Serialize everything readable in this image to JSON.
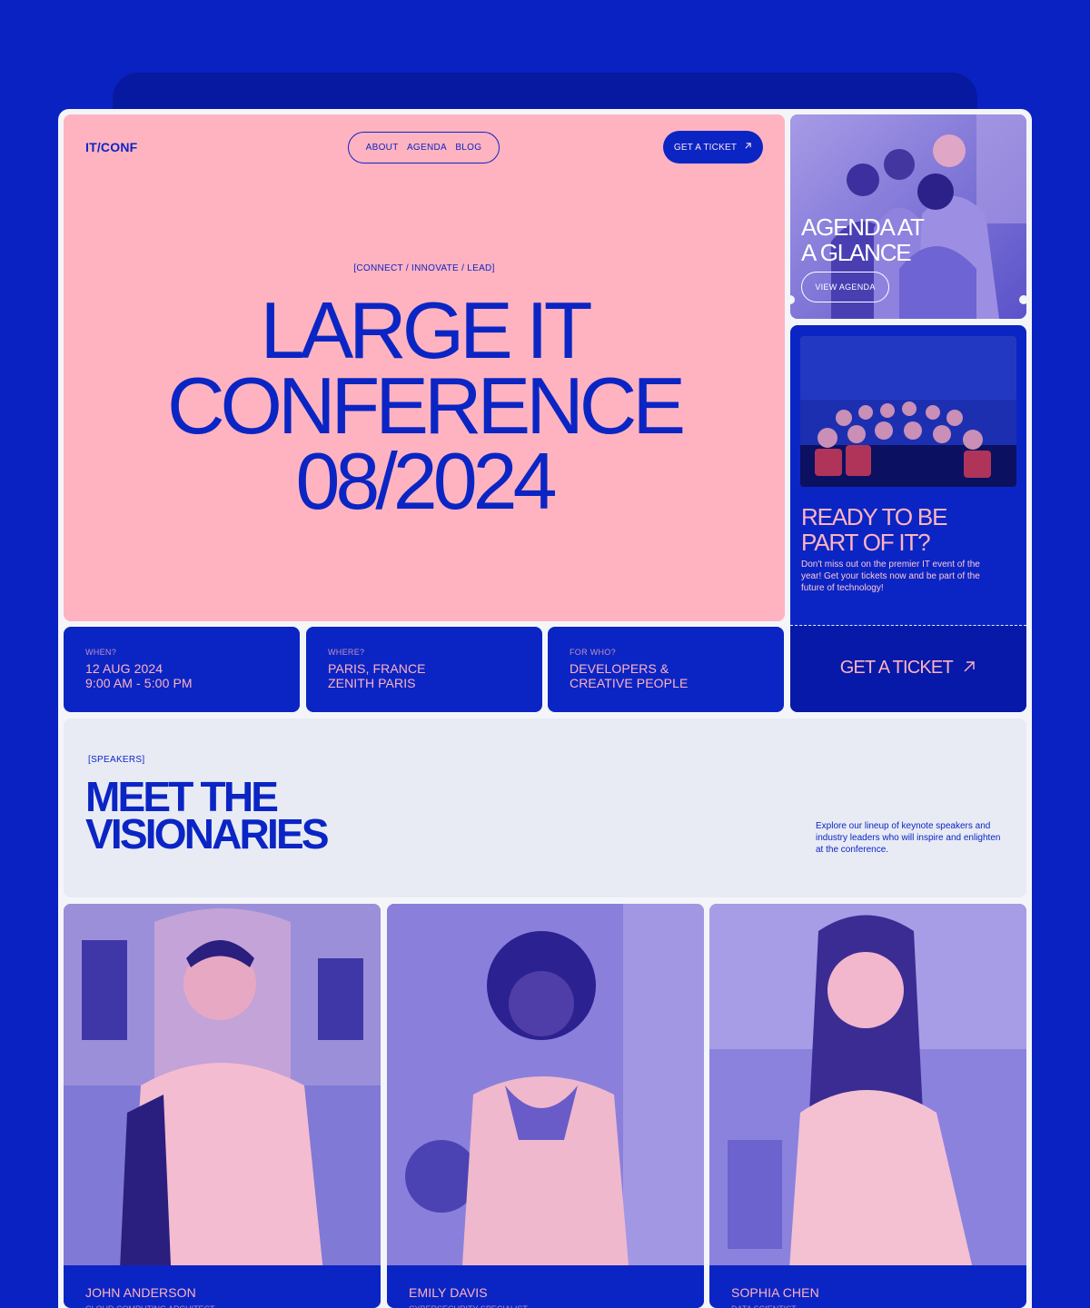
{
  "brand": {
    "logo": "IT/CONF"
  },
  "nav": {
    "items": [
      "ABOUT",
      "AGENDA",
      "BLOG"
    ],
    "cta": "GET A TICKET",
    "cta_icon": "arrow-up-right-icon"
  },
  "hero": {
    "tagline": "[CONNECT / INNOVATE / LEAD]",
    "title_lines": [
      "LARGE IT",
      "CONFERENCE",
      "08/2024"
    ]
  },
  "agenda_card": {
    "title_lines": [
      "AGENDA AT",
      "A GLANCE"
    ],
    "button": "VIEW AGENDA"
  },
  "ready_card": {
    "title_lines": [
      "READY TO BE",
      "PART OF IT?"
    ],
    "text": "Don't miss out on the premier IT event of the year! Get your tickets now and be part of the future of technology!",
    "cta": "GET A TICKET",
    "cta_icon": "arrow-up-right-icon"
  },
  "info": [
    {
      "label": "WHEN?",
      "lines": [
        "12 AUG 2024",
        "9:00 AM - 5:00 PM"
      ]
    },
    {
      "label": "WHERE?",
      "lines": [
        "PARIS, FRANCE",
        "ZENITH PARIS"
      ]
    },
    {
      "label": "FOR WHO?",
      "lines": [
        "DEVELOPERS &",
        "CREATIVE PEOPLE"
      ]
    }
  ],
  "speakers_section": {
    "tag": "[SPEAKERS]",
    "title_lines": [
      "MEET THE",
      "VISIONARIES"
    ],
    "description": "Explore our lineup of keynote speakers and industry leaders who will inspire and enlighten at the conference."
  },
  "speakers": [
    {
      "name": "JOHN ANDERSON",
      "role": "CLOUD COMPUTING ARCHITECT"
    },
    {
      "name": "EMILY DAVIS",
      "role": "CYBERSECURITY SPECIALIST"
    },
    {
      "name": "SOPHIA CHEN",
      "role": "DATA SCIENTIST"
    }
  ],
  "colors": {
    "primary": "#0b25c4",
    "pink": "#ffb3c0",
    "background": "#0a22c2",
    "light": "#e8ebf4"
  }
}
